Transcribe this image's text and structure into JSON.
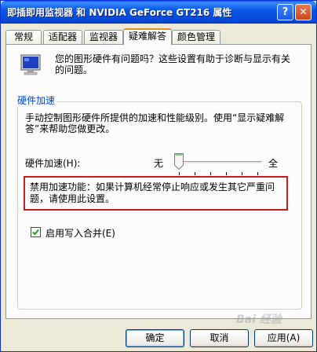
{
  "window": {
    "title": "即插即用监视器 和 NVIDIA GeForce GT216 属性",
    "help_label": "?",
    "close_label": "✕"
  },
  "tabs": [
    {
      "label": "常规"
    },
    {
      "label": "适配器"
    },
    {
      "label": "监视器"
    },
    {
      "label": "疑难解答",
      "active": true
    },
    {
      "label": "颜色管理"
    }
  ],
  "panel": {
    "intro": "您的图形硬件有问题吗？这些设置有助于诊断与显示有关的问题。",
    "group_title": "硬件加速",
    "description": "手动控制图形硬件所提供的加速和性能级别。使用“显示疑难解答”来帮助您做更改。",
    "accel_label": "硬件加速(H):",
    "slider_min_label": "无",
    "slider_max_label": "全",
    "slider_level": 0,
    "warning": "禁用加速功能：如果计算机经常停止响应或发生其它严重问题，请使用此设置。",
    "write_combining_label": "启用写入合并(E)",
    "write_combining_checked": true
  },
  "buttons": {
    "ok": "确定",
    "cancel": "取消",
    "apply": "应用(A)"
  },
  "watermark": "Bai 经验",
  "icons": {
    "monitor": "monitor-icon",
    "checkmark": "checkmark-icon"
  },
  "colors": {
    "titlebar": "#0a58e6",
    "tab_active_accent": "#e68b2c",
    "warning_border": "#c81e1e",
    "legend_text": "#0046d5"
  }
}
